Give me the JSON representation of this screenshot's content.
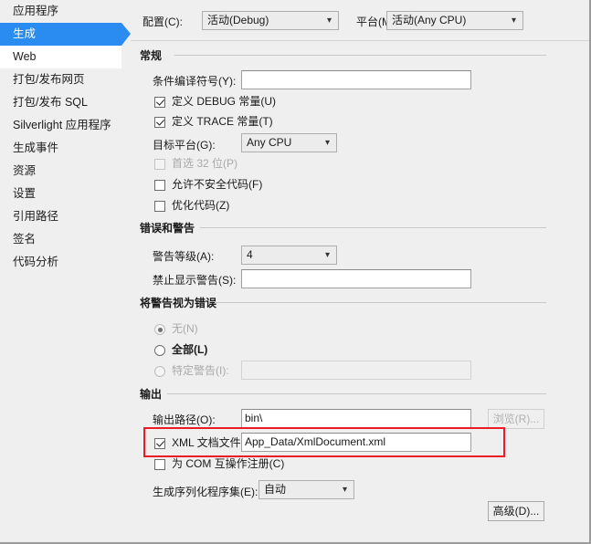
{
  "sidebar": {
    "items": [
      {
        "label": "应用程序",
        "state": "normal"
      },
      {
        "label": "生成",
        "state": "selected"
      },
      {
        "label": "Web",
        "state": "hover"
      },
      {
        "label": "打包/发布网页",
        "state": "normal"
      },
      {
        "label": "打包/发布 SQL",
        "state": "normal"
      },
      {
        "label": "Silverlight 应用程序",
        "state": "normal"
      },
      {
        "label": "生成事件",
        "state": "normal"
      },
      {
        "label": "资源",
        "state": "normal"
      },
      {
        "label": "设置",
        "state": "normal"
      },
      {
        "label": "引用路径",
        "state": "normal"
      },
      {
        "label": "签名",
        "state": "normal"
      },
      {
        "label": "代码分析",
        "state": "normal"
      }
    ],
    "selected_color": "#2a8bf0"
  },
  "toolbar": {
    "configuration_label": "配置(C):",
    "configuration_value": "活动(Debug)",
    "platform_label": "平台(M):",
    "platform_value": "活动(Any CPU)"
  },
  "general": {
    "group_title": "常规",
    "conditional_symbols_label": "条件编译符号(Y):",
    "conditional_symbols_value": "",
    "define_debug_label": "定义 DEBUG 常量(U)",
    "define_debug_checked": true,
    "define_trace_label": "定义 TRACE 常量(T)",
    "define_trace_checked": true,
    "target_platform_label": "目标平台(G):",
    "target_platform_value": "Any CPU",
    "prefer32_label": "首选 32 位(P)",
    "prefer32_checked": false,
    "prefer32_disabled": true,
    "allow_unsafe_label": "允许不安全代码(F)",
    "allow_unsafe_checked": false,
    "optimize_label": "优化代码(Z)",
    "optimize_checked": false
  },
  "errors_warnings": {
    "group_title": "错误和警告",
    "warning_level_label": "警告等级(A):",
    "warning_level_value": "4",
    "suppress_warnings_label": "禁止显示警告(S):",
    "suppress_warnings_value": ""
  },
  "treat_warnings": {
    "group_title": "将警告视为错误",
    "none_label": "无(N)",
    "none_selected": true,
    "none_disabled": true,
    "all_label": "全部(L)",
    "all_selected": false,
    "specific_label": "特定警告(I):",
    "specific_selected": false,
    "specific_disabled": true,
    "specific_value": ""
  },
  "output": {
    "group_title": "输出",
    "output_path_label": "输出路径(O):",
    "output_path_value": "bin\\",
    "browse_label": "浏览(R)...",
    "browse_disabled": true,
    "xml_doc_label": "XML 文档文件(X):",
    "xml_doc_checked": true,
    "xml_doc_value": "App_Data/XmlDocument.xml",
    "register_com_label": "为 COM 互操作注册(C)",
    "register_com_checked": false,
    "serialization_label": "生成序列化程序集(E):",
    "serialization_value": "自动",
    "advanced_label": "高级(D)..."
  },
  "annotation": {
    "highlight_color": "#ee1b24"
  }
}
